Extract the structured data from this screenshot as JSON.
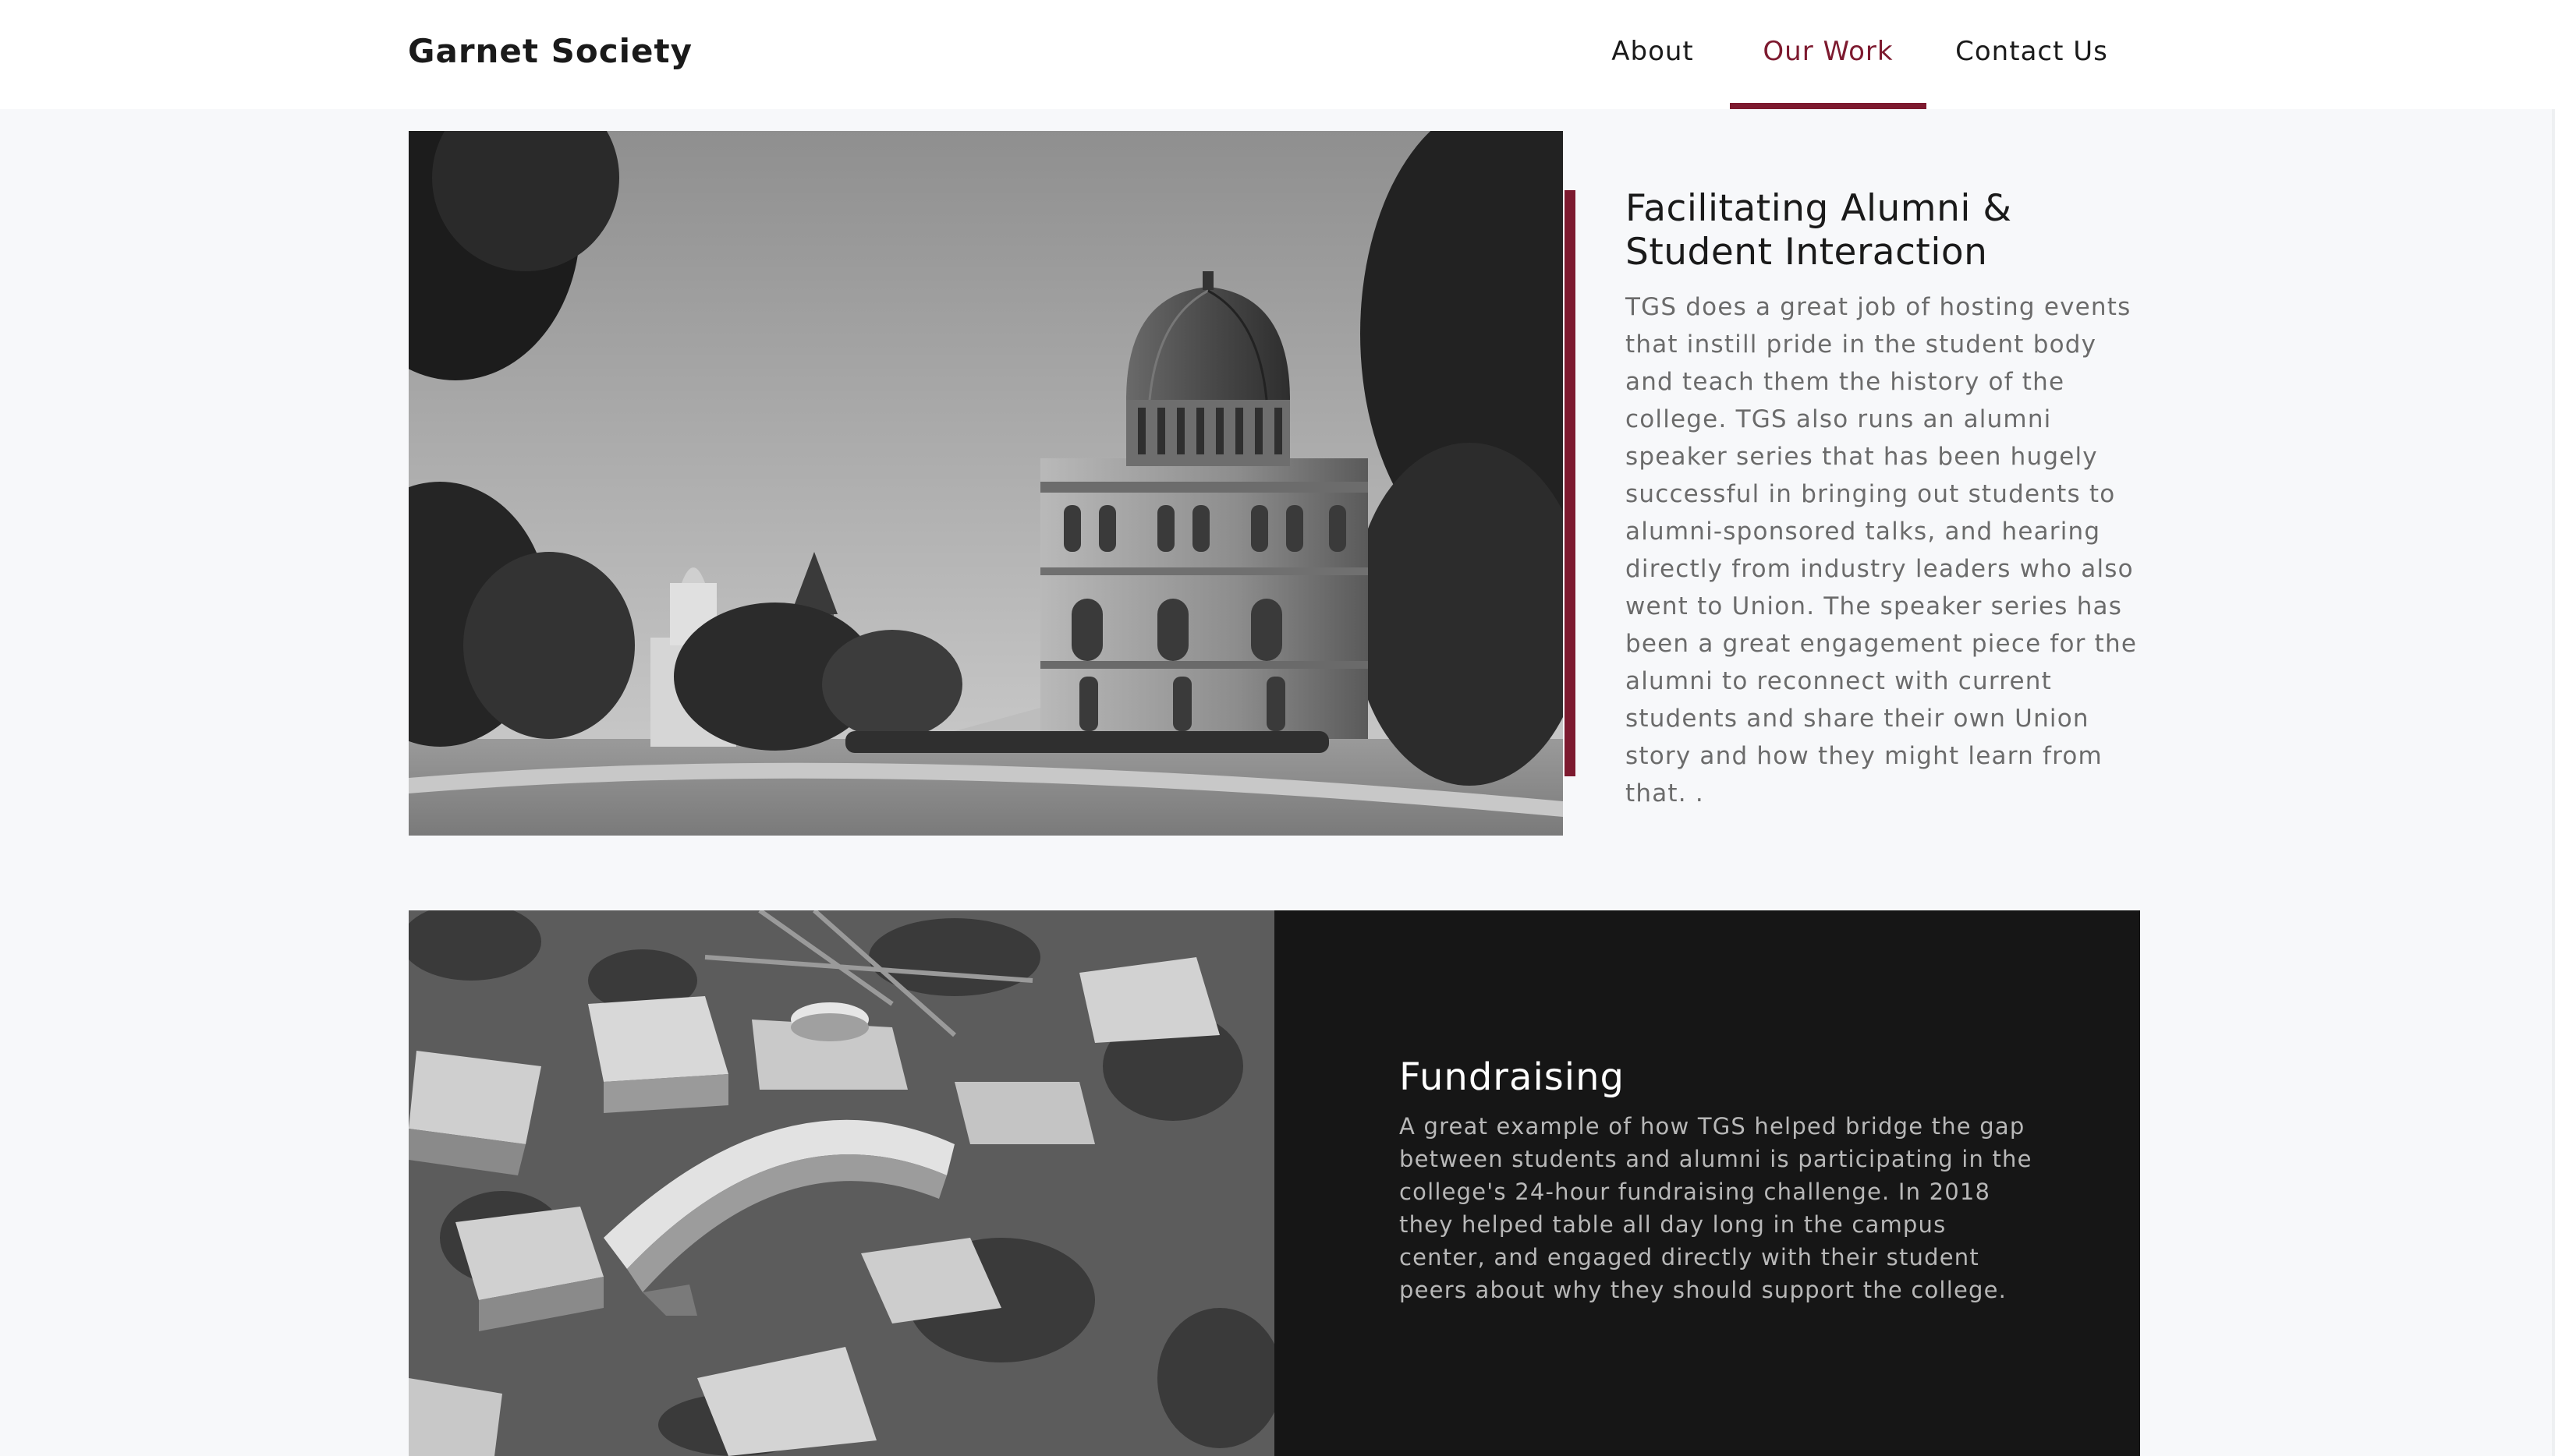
{
  "header": {
    "brand": "Garnet Society",
    "nav": [
      {
        "label": "About",
        "active": false
      },
      {
        "label": "Our Work",
        "active": true
      },
      {
        "label": "Contact Us",
        "active": false
      }
    ]
  },
  "sections": [
    {
      "title": "Facilitating Alumni & Student Interaction",
      "body": "TGS does a great job of hosting events that instill pride in the student body and teach them the history of the college. TGS also runs an alumni speaker series that has been hugely successful in bringing out students to alumni-sponsored talks, and hearing directly from industry leaders who also went to Union. The speaker series has been a great engagement piece for the alumni to reconnect with current students and share their own Union story and how they might learn from that. ."
    },
    {
      "title": "Fundraising",
      "body": "A great example of how TGS helped bridge the gap between students and alumni is participating in the college's 24-hour fundraising challenge. In 2018 they helped table all day long in the campus center, and engaged directly with their student peers about why they should support the college."
    }
  ],
  "colors": {
    "accent": "#7d1a2f",
    "page_background": "#f7f8fa",
    "dark_panel": "#161616"
  }
}
